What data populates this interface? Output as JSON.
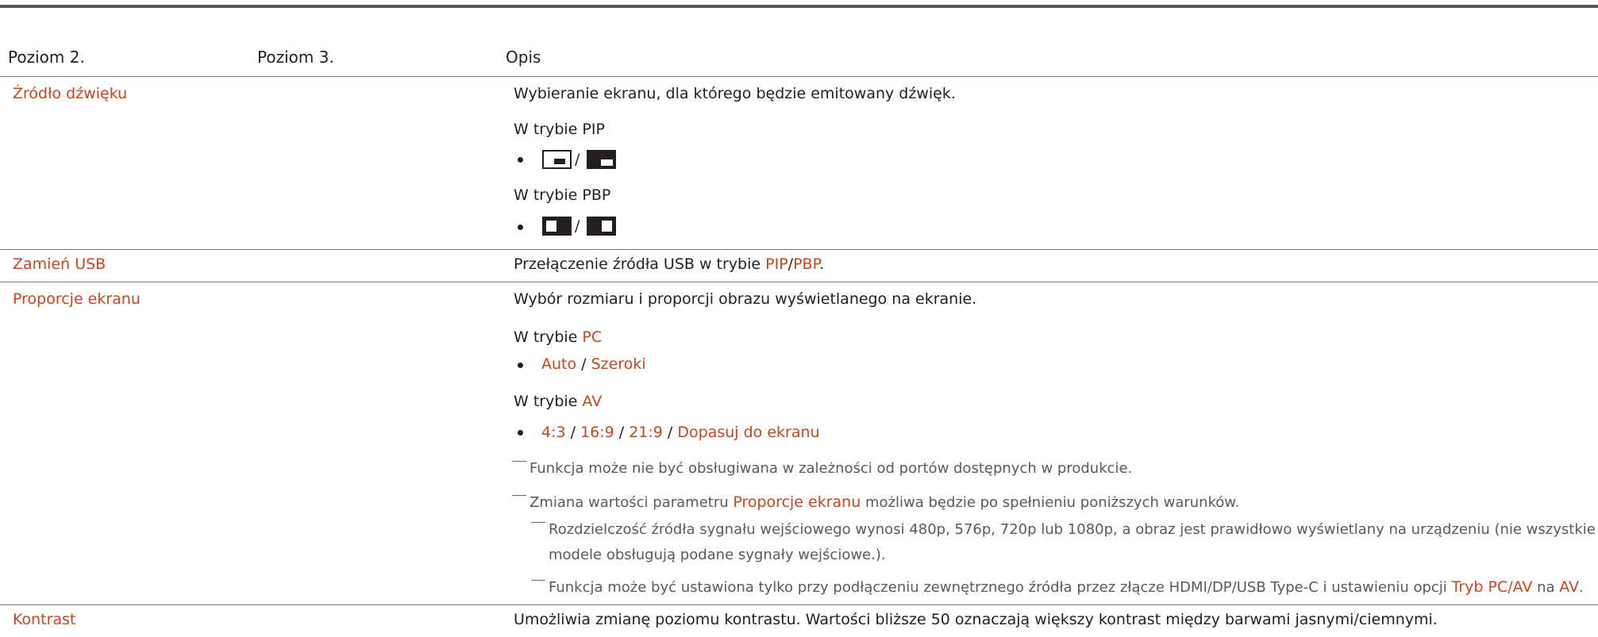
{
  "header": {
    "col1": "Poziom 2.",
    "col2": "Poziom 3.",
    "col3": "Opis"
  },
  "rows": {
    "zrodlo": {
      "name": "Źródło dźwięku",
      "desc": "Wybieranie ekranu, dla którego będzie emitowany dźwięk.",
      "mode_pip": "W trybie PIP",
      "mode_pbp": "W trybie PBP",
      "slash": "/"
    },
    "usb": {
      "name": "Zamień USB",
      "desc_pre": "Przełączenie źródła USB w trybie ",
      "pip": "PIP",
      "slash": "/",
      "pbp": "PBP",
      "dot": "."
    },
    "proporcje": {
      "name": "Proporcje ekranu",
      "desc": "Wybór rozmiaru i proporcji obrazu wyświetlanego na ekranie.",
      "mode_pc_pre": "W trybie ",
      "mode_pc": "PC",
      "opt_auto": "Auto",
      "sep": " / ",
      "opt_szeroki": "Szeroki",
      "mode_av_pre": "W trybie ",
      "mode_av": "AV",
      "opt_43": "4:3",
      "opt_169": "16:9",
      "opt_219": "21:9",
      "opt_dopasuj": "Dopasuj do ekranu",
      "note1": "Funkcja może nie być obsługiwana w zależności od portów dostępnych w produkcie.",
      "note2_pre": "Zmiana wartości parametru ",
      "note2_term": "Proporcje ekranu",
      "note2_post": " możliwa będzie po spełnieniu poniższych warunków.",
      "sub1_line1": "Rozdzielczość źródła sygnału wejściowego wynosi 480p, 576p, 720p lub 1080p, a obraz jest prawidłowo wyświetlany na urządzeniu (nie wszystkie",
      "sub1_line2": "modele obsługują podane sygnały wejściowe.).",
      "sub2_pre": "Funkcja może być ustawiona tylko przy podłączeniu zewnętrznego źródła przez złącze HDMI/DP/USB Type-C i ustawieniu opcji ",
      "sub2_term1": "Tryb PC/AV",
      "sub2_mid": " na ",
      "sub2_term2": "AV",
      "sub2_end": "."
    },
    "kontrast": {
      "name": "Kontrast",
      "desc": "Umożliwia zmianę poziomu kontrastu. Wartości bliższe 50 oznaczają większy kontrast między barwami jasnymi/ciemnymi."
    }
  },
  "icons": [
    "pip-bottom-right-icon",
    "pip-top-left-icon",
    "pbp-left-icon",
    "pbp-right-icon"
  ],
  "colors": {
    "accent": "#c8461b",
    "text": "#231f20",
    "note": "#5a5a5a",
    "rule": "#808080"
  }
}
